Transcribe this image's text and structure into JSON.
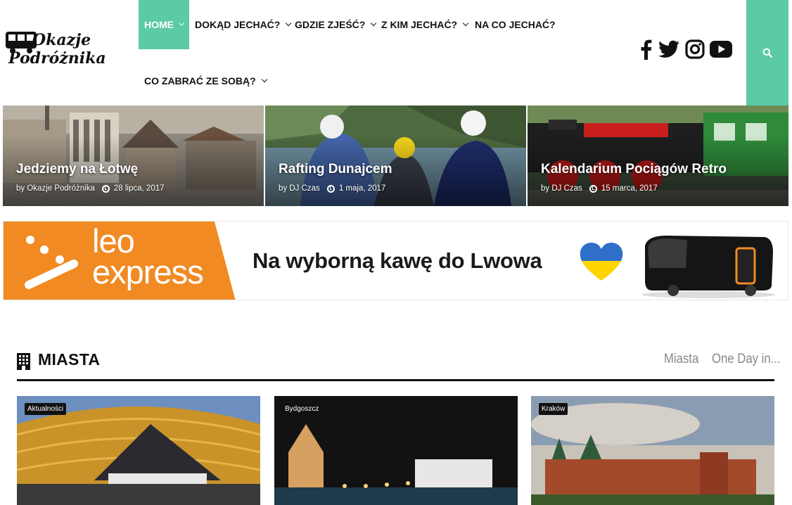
{
  "header": {
    "logo_line1": "Okazje",
    "logo_line2": "Podróżnika",
    "nav": [
      {
        "label": "HOME",
        "active": true
      },
      {
        "label": "DOKĄD JECHAĆ?"
      },
      {
        "label": "GDZIE ZJEŚĆ?"
      },
      {
        "label": "Z KIM JECHAĆ?"
      },
      {
        "label": "NA CO JECHAĆ?"
      },
      {
        "label": "CO ZABRAĆ ZE SOBĄ?"
      }
    ],
    "social": [
      "facebook-icon",
      "twitter-icon",
      "instagram-icon",
      "youtube-icon"
    ],
    "search_icon": "search-icon",
    "accent": "#5cc9a7"
  },
  "featured": [
    {
      "title": "Jedziemy na Łotwę",
      "by": "by",
      "author": "Okazje Podróżnika",
      "date": "28 lipca, 2017"
    },
    {
      "title": "Rafting Dunajcem",
      "by": "by",
      "author": "DJ Czas",
      "date": "1 maja, 2017"
    },
    {
      "title": "Kalendarium Pociągów Retro",
      "by": "by",
      "author": "DJ Czas",
      "date": "15 marca, 2017"
    }
  ],
  "banner": {
    "brand_line1": "leo",
    "brand_line2": "express",
    "slogan": "Na wyborną kawę do Lwowa",
    "brand_color": "#f18a22"
  },
  "section": {
    "title": "MIASTA",
    "tabs": [
      "Miasta",
      "One Day in..."
    ],
    "cards": [
      {
        "category": "Aktualności"
      },
      {
        "category": "Bydgoszcz"
      },
      {
        "category": "Kraków"
      }
    ]
  }
}
